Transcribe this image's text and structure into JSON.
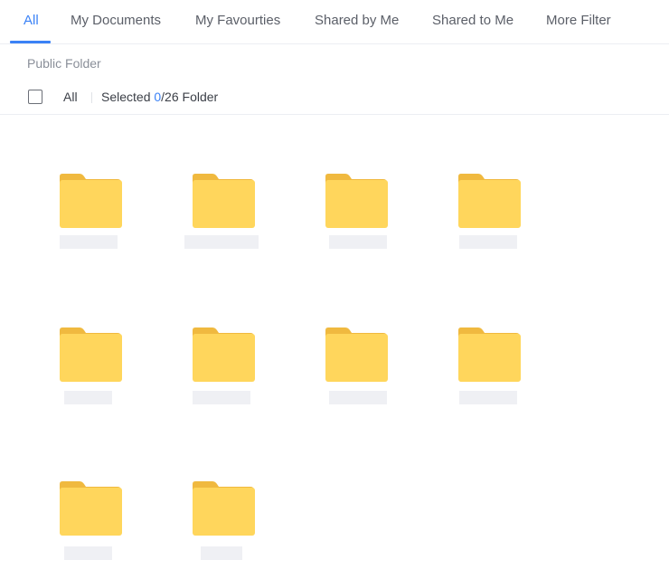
{
  "tabs": [
    {
      "label": "All",
      "active": true
    },
    {
      "label": "My Documents",
      "active": false
    },
    {
      "label": "My Favourties",
      "active": false
    },
    {
      "label": "Shared by Me",
      "active": false
    },
    {
      "label": "Shared to Me",
      "active": false
    },
    {
      "label": "More Filter",
      "active": false
    }
  ],
  "section": {
    "title": "Public Folder"
  },
  "selection": {
    "all_label": "All",
    "selected_prefix": "Selected",
    "selected_count": "0",
    "total": "/26",
    "suffix": "Folder"
  },
  "colors": {
    "accent": "#3b82f6",
    "folder_front": "#ffd65c",
    "folder_back": "#f0b93f",
    "placeholder": "#eff0f4"
  },
  "folders": [
    {
      "icon": "folder-icon"
    },
    {
      "icon": "folder-icon"
    },
    {
      "icon": "folder-icon"
    },
    {
      "icon": "folder-icon"
    },
    {
      "icon": "folder-icon"
    },
    {
      "icon": "folder-icon"
    },
    {
      "icon": "folder-icon"
    },
    {
      "icon": "folder-icon"
    },
    {
      "icon": "folder-icon"
    },
    {
      "icon": "folder-icon"
    }
  ]
}
